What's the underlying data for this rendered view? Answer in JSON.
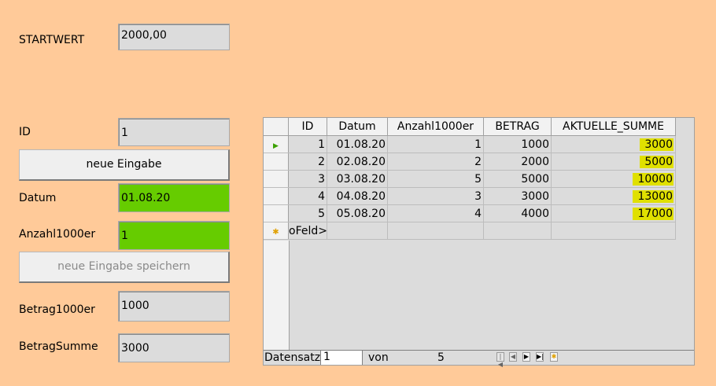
{
  "form": {
    "startwert_label": "STARTWERT",
    "startwert_value": "2000,00",
    "id_label": "ID",
    "id_value": "1",
    "btn_neue_eingabe": "neue Eingabe",
    "datum_label": "Datum",
    "datum_value": "01.08.20",
    "anzahl_label": "Anzahl1000er",
    "anzahl_value": "1",
    "btn_speichern": "neue Eingabe speichern",
    "betrag_label": "Betrag1000er",
    "betrag_value": "1000",
    "betragsumme_label": "BetragSumme",
    "betragsumme_value": "3000"
  },
  "grid": {
    "columns": [
      "ID",
      "Datum",
      "Anzahl1000er",
      "BETRAG",
      "AKTUELLE_SUMME"
    ],
    "rows": [
      [
        "1",
        "01.08.20",
        "1",
        "1000",
        "3000"
      ],
      [
        "2",
        "02.08.20",
        "2",
        "2000",
        "5000"
      ],
      [
        "3",
        "03.08.20",
        "5",
        "5000",
        "10000"
      ],
      [
        "4",
        "04.08.20",
        "3",
        "3000",
        "13000"
      ],
      [
        "5",
        "05.08.20",
        "4",
        "4000",
        "17000"
      ]
    ],
    "new_row_text": "oFeld>",
    "current_row_icon": "play-triangle-icon",
    "new_row_icon": "new-record-star-icon",
    "highlight_color": "#e0e000"
  },
  "navbar": {
    "datensatz_label": "Datensatz",
    "record_value": "1",
    "von_label": "von",
    "total_value": "5",
    "icons": [
      "first-record-icon",
      "previous-record-icon",
      "next-record-icon",
      "last-record-icon",
      "new-record-icon"
    ]
  },
  "colors": {
    "background": "#ffca99",
    "field": "#dcdcdc",
    "green_field": "#66cc00"
  }
}
